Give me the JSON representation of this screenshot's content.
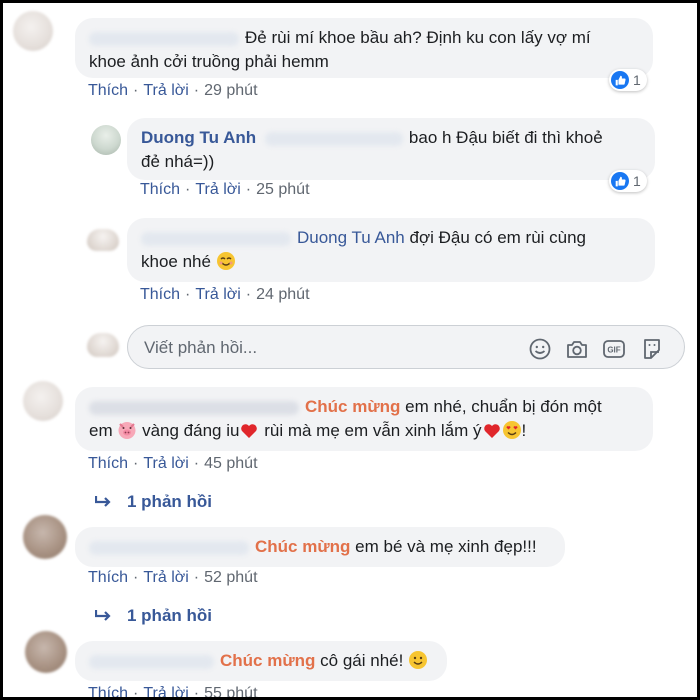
{
  "actions": {
    "like": "Thích",
    "reply": "Trả lời",
    "sep": "·"
  },
  "comments": [
    {
      "text": "Đẻ rùi mí khoe bầu ah? Định ku con lấy vợ mí khoe ảnh cởi truồng phải hemm",
      "line1": "Đẻ rùi mí khoe bầu ah? Định ku con lấy vợ mí",
      "line2": "khoe ảnh cởi truồng phải hemm",
      "time": "29 phút",
      "reactions": "1"
    },
    {
      "author": "Duong Tu Anh",
      "line1": "bao h Đậu biết đi thì khoẻ",
      "line2": "đẻ nhá=))",
      "time": "25 phút",
      "reactions": "1"
    },
    {
      "mention": "Duong Tu Anh",
      "line1": "đợi Đậu có em rùi cùng",
      "line2": "khoe nhé",
      "time": "24 phút"
    },
    {
      "mention": "Chúc mừng",
      "line1": "em nhé, chuẩn bị đón một",
      "line2a": "em",
      "line2b": "vàng đáng iu",
      "line2c": "rùi mà mẹ em vẫn xinh lắm ý",
      "line2d": "!",
      "time": "45 phút",
      "more": "1 phản hồi"
    },
    {
      "mention": "Chúc mừng",
      "text": "em bé và mẹ xinh đẹp!!!",
      "time": "52 phút",
      "more": "1 phản hồi"
    },
    {
      "mention": "Chúc mừng",
      "text": "cô gái nhé!",
      "time": "55 phút"
    }
  ],
  "reply_box": {
    "placeholder": "Viết phản hồi..."
  },
  "icons": [
    "smiley-icon",
    "camera-icon",
    "gif-icon",
    "sticker-icon",
    "like-icon",
    "reply-arrow-icon"
  ],
  "colors": {
    "link": "#385898",
    "highlight": "#e2714a",
    "bubble": "#f2f3f5",
    "like": "#1877f2"
  }
}
